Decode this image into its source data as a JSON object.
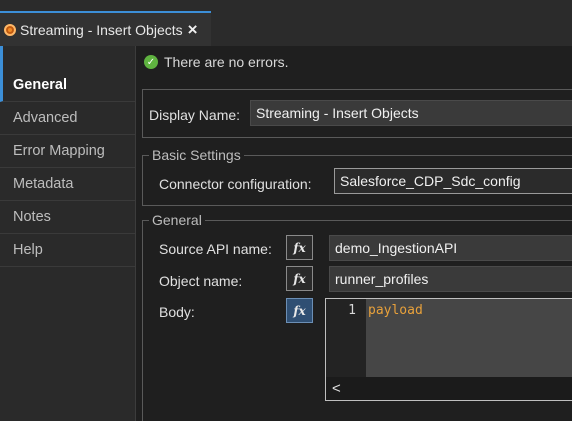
{
  "tab": {
    "title": "Streaming - Insert Objects",
    "close_glyph": "×"
  },
  "nav": {
    "items": [
      "General",
      "Advanced",
      "Error Mapping",
      "Metadata",
      "Notes",
      "Help"
    ]
  },
  "status": {
    "message": "There are no errors."
  },
  "display": {
    "label": "Display Name:",
    "value": "Streaming - Insert Objects"
  },
  "basic": {
    "legend": "Basic Settings",
    "connector_label": "Connector configuration:",
    "connector_value": "Salesforce_CDP_Sdc_config"
  },
  "general": {
    "legend": "General",
    "source_label": "Source API name:",
    "source_value": "demo_IngestionAPI",
    "object_label": "Object name:",
    "object_value": "runner_profiles",
    "body_label": "Body:",
    "fx_glyph": "fx",
    "line_number": "1",
    "body_value": "payload",
    "scroll_glyph": "<"
  },
  "colors": {
    "accent": "#3c8fd8",
    "success": "#5fb340",
    "code": "#e8a13b"
  }
}
